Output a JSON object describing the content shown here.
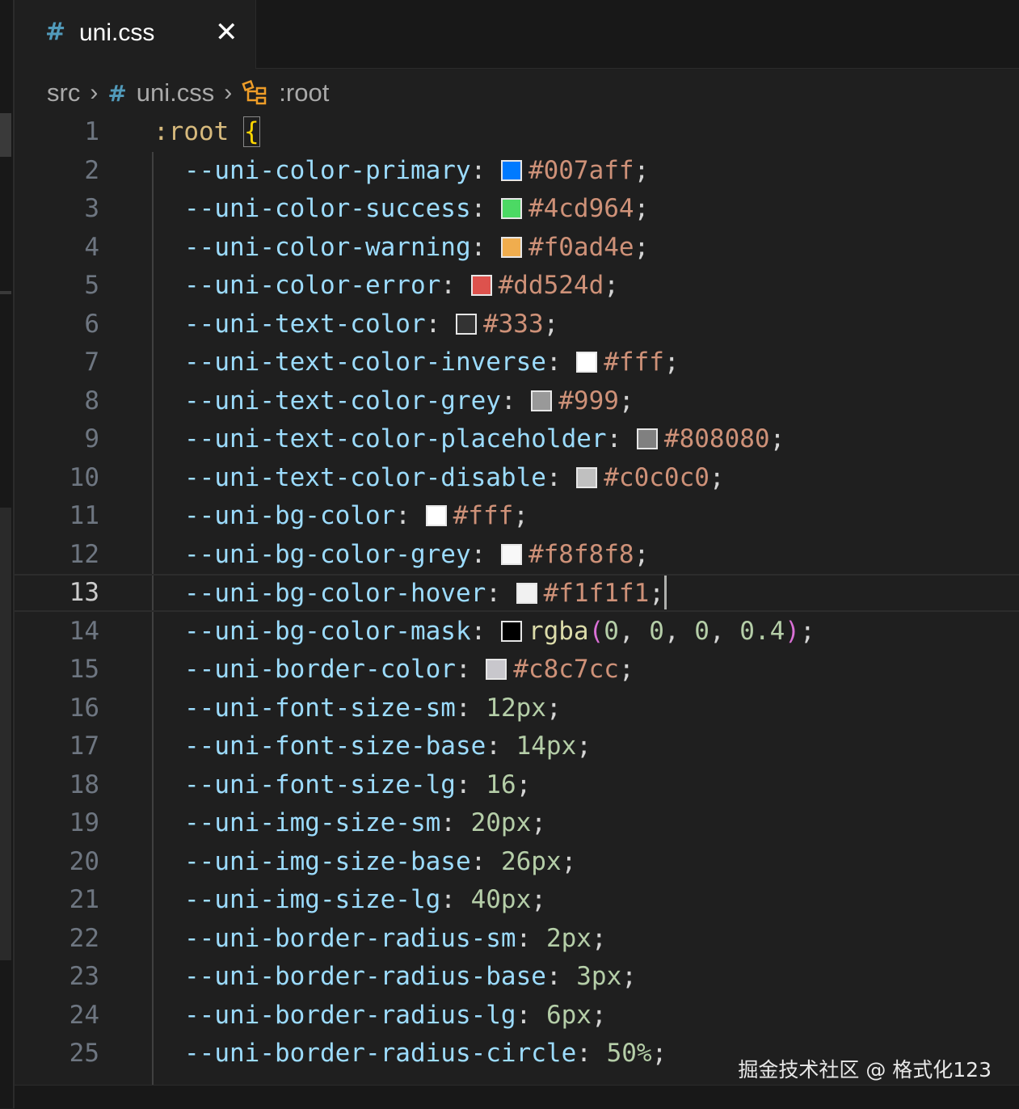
{
  "tab": {
    "icon": "#",
    "name": "uni.css",
    "close": "✕"
  },
  "breadcrumb": {
    "folder": "src",
    "file_icon": "#",
    "file": "uni.css",
    "symbol": ":root"
  },
  "editor": {
    "current_line": 13,
    "lines": [
      {
        "n": "1",
        "kind": "open",
        "sel": ":root",
        "brace": "{"
      },
      {
        "n": "2",
        "kind": "color",
        "prop": "--uni-color-primary",
        "swatch": "#007aff",
        "value": "#007aff"
      },
      {
        "n": "3",
        "kind": "color",
        "prop": "--uni-color-success",
        "swatch": "#4cd964",
        "value": "#4cd964"
      },
      {
        "n": "4",
        "kind": "color",
        "prop": "--uni-color-warning",
        "swatch": "#f0ad4e",
        "value": "#f0ad4e"
      },
      {
        "n": "5",
        "kind": "color",
        "prop": "--uni-color-error",
        "swatch": "#dd524d",
        "value": "#dd524d"
      },
      {
        "n": "6",
        "kind": "color",
        "prop": "--uni-text-color",
        "swatch": "#333333",
        "value": "#333"
      },
      {
        "n": "7",
        "kind": "color",
        "prop": "--uni-text-color-inverse",
        "swatch": "#ffffff",
        "value": "#fff"
      },
      {
        "n": "8",
        "kind": "color",
        "prop": "--uni-text-color-grey",
        "swatch": "#999999",
        "value": "#999"
      },
      {
        "n": "9",
        "kind": "color",
        "prop": "--uni-text-color-placeholder",
        "swatch": "#808080",
        "value": "#808080"
      },
      {
        "n": "10",
        "kind": "color",
        "prop": "--uni-text-color-disable",
        "swatch": "#c0c0c0",
        "value": "#c0c0c0"
      },
      {
        "n": "11",
        "kind": "color",
        "prop": "--uni-bg-color",
        "swatch": "#ffffff",
        "value": "#fff"
      },
      {
        "n": "12",
        "kind": "color",
        "prop": "--uni-bg-color-grey",
        "swatch": "#f8f8f8",
        "value": "#f8f8f8"
      },
      {
        "n": "13",
        "kind": "color",
        "prop": "--uni-bg-color-hover",
        "swatch": "#f1f1f1",
        "value": "#f1f1f1"
      },
      {
        "n": "14",
        "kind": "rgba",
        "prop": "--uni-bg-color-mask",
        "swatch": "#000000",
        "fn": "rgba",
        "args": [
          "0",
          "0",
          "0",
          "0.4"
        ]
      },
      {
        "n": "15",
        "kind": "color",
        "prop": "--uni-border-color",
        "swatch": "#c8c7cc",
        "value": "#c8c7cc"
      },
      {
        "n": "16",
        "kind": "num",
        "prop": "--uni-font-size-sm",
        "value": "12px"
      },
      {
        "n": "17",
        "kind": "num",
        "prop": "--uni-font-size-base",
        "value": "14px"
      },
      {
        "n": "18",
        "kind": "num",
        "prop": "--uni-font-size-lg",
        "value": "16"
      },
      {
        "n": "19",
        "kind": "num",
        "prop": "--uni-img-size-sm",
        "value": "20px"
      },
      {
        "n": "20",
        "kind": "num",
        "prop": "--uni-img-size-base",
        "value": "26px"
      },
      {
        "n": "21",
        "kind": "num",
        "prop": "--uni-img-size-lg",
        "value": "40px"
      },
      {
        "n": "22",
        "kind": "num",
        "prop": "--uni-border-radius-sm",
        "value": "2px"
      },
      {
        "n": "23",
        "kind": "num",
        "prop": "--uni-border-radius-base",
        "value": "3px"
      },
      {
        "n": "24",
        "kind": "num",
        "prop": "--uni-border-radius-lg",
        "value": "6px"
      },
      {
        "n": "25",
        "kind": "num",
        "prop": "--uni-border-radius-circle",
        "value": "50%"
      }
    ]
  },
  "watermark": "掘金技术社区 @ 格式化123"
}
